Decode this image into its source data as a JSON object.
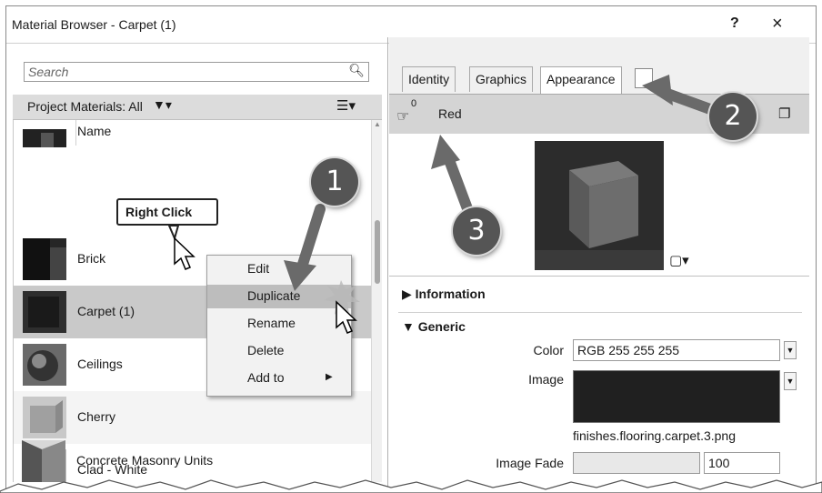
{
  "window": {
    "title": "Material Browser - Carpet (1)",
    "help_label": "?",
    "close_label": "×"
  },
  "left": {
    "search_placeholder": "Search",
    "project_materials_label": "Project Materials: All",
    "column_header": "Name",
    "materials": [
      {
        "name": "Brick"
      },
      {
        "name": "Carpet (1)"
      },
      {
        "name": "Ceilings"
      },
      {
        "name": "Cherry"
      },
      {
        "name": "Clad - White"
      },
      {
        "name": "Concrete Masonry Units"
      }
    ]
  },
  "context_menu": {
    "items": [
      "Edit",
      "Duplicate",
      "Rename",
      "Delete",
      "Add to"
    ]
  },
  "tooltip": "Right Click",
  "right": {
    "tabs": [
      "Identity",
      "Graphics",
      "Appearance"
    ],
    "asset_count": "0",
    "asset_name": "Red",
    "sections": {
      "information": "Information",
      "generic": "Generic"
    },
    "properties": {
      "color_label": "Color",
      "color_value": "RGB 255 255 255",
      "image_label": "Image",
      "image_filename": "finishes.flooring.carpet.3.png",
      "image_fade_label": "Image Fade",
      "image_fade_value": "100"
    }
  },
  "callouts": [
    "1",
    "2",
    "3"
  ],
  "colors": {
    "selected_row": "#c9c9c9",
    "menu_highlight": "#bdbdbd",
    "callout": "#555555",
    "arrow": "#6a6a6a"
  }
}
